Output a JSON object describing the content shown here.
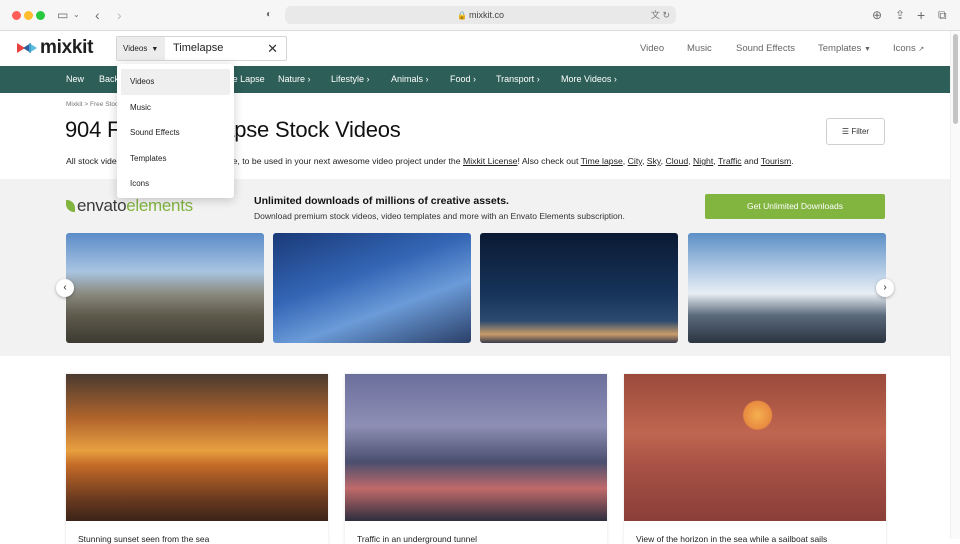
{
  "browser": {
    "url": "mixkit.co",
    "icons": [
      "sidebar-icon",
      "chevron-down-icon",
      "back-icon",
      "forward-icon",
      "shield-icon",
      "lock-icon",
      "translate-icon",
      "reload-icon",
      "download-icon",
      "share-icon",
      "new-tab-icon",
      "tabs-icon"
    ]
  },
  "header": {
    "logo": "mixkit",
    "search": {
      "category": "Videos",
      "query": "Timelapse"
    },
    "nav": [
      {
        "label": "Video"
      },
      {
        "label": "Music"
      },
      {
        "label": "Sound Effects"
      },
      {
        "label": "Templates"
      },
      {
        "label": "Icons"
      }
    ]
  },
  "dropdown": {
    "items": [
      "Videos",
      "Music",
      "Sound Effects",
      "Templates",
      "Icons"
    ],
    "selected": "Videos"
  },
  "categories": [
    "New",
    "Backgrounds",
    "Time Lapse",
    "Nature",
    "Lifestyle",
    "Animals",
    "Food",
    "Transport",
    "More Videos"
  ],
  "breadcrumb": [
    "Mixkit",
    "Free Stock Videos"
  ],
  "page": {
    "title": "904 Free Time Lapse Stock Videos",
    "filter_label": "Filter",
    "description": {
      "pre": "All stock videos are free to download for free, to be used in your next awesome video project under the ",
      "license": "Mixkit License",
      "mid": "! Also check out ",
      "links": [
        "Time lapse",
        "City",
        "Sky",
        "Cloud",
        "Night",
        "Traffic"
      ],
      "and": " and ",
      "last": "Tourism",
      "end": "."
    }
  },
  "promo": {
    "brand_a": "envato",
    "brand_b": "elements",
    "headline": "Unlimited downloads of millions of creative assets.",
    "sub": "Download premium stock videos, video templates and more with an Envato Elements subscription.",
    "button": "Get Unlimited Downloads",
    "accent": "#82b440"
  },
  "videos": [
    {
      "caption": "Stunning sunset seen from the sea"
    },
    {
      "caption": "Traffic in an underground tunnel"
    },
    {
      "caption": "View of the horizon in the sea while a sailboat sails"
    }
  ],
  "colors": {
    "category_bar": "#2d5e58",
    "envato_green": "#82b440"
  }
}
